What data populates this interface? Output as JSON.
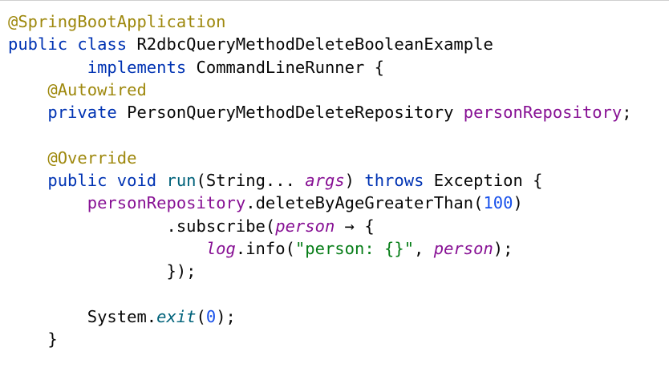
{
  "code_lines": [
    [
      {
        "kind": "annotation",
        "text": "@SpringBootApplication"
      }
    ],
    [
      {
        "kind": "keyword",
        "text": "public"
      },
      {
        "kind": "plain",
        "text": " "
      },
      {
        "kind": "keyword",
        "text": "class"
      },
      {
        "kind": "plain",
        "text": " R2dbcQueryMethodDeleteBooleanExample"
      }
    ],
    [
      {
        "kind": "plain",
        "text": "        "
      },
      {
        "kind": "keyword",
        "text": "implements"
      },
      {
        "kind": "plain",
        "text": " CommandLineRunner {"
      }
    ],
    [
      {
        "kind": "plain",
        "text": "    "
      },
      {
        "kind": "annotation",
        "text": "@Autowired"
      }
    ],
    [
      {
        "kind": "plain",
        "text": "    "
      },
      {
        "kind": "keyword",
        "text": "private"
      },
      {
        "kind": "plain",
        "text": " PersonQueryMethodDeleteRepository "
      },
      {
        "kind": "field",
        "text": "personRepository"
      },
      {
        "kind": "plain",
        "text": ";"
      }
    ],
    [],
    [
      {
        "kind": "plain",
        "text": "    "
      },
      {
        "kind": "annotation",
        "text": "@Override"
      }
    ],
    [
      {
        "kind": "plain",
        "text": "    "
      },
      {
        "kind": "keyword",
        "text": "public"
      },
      {
        "kind": "plain",
        "text": " "
      },
      {
        "kind": "keyword",
        "text": "void"
      },
      {
        "kind": "plain",
        "text": " "
      },
      {
        "kind": "method-decl",
        "text": "run"
      },
      {
        "kind": "plain",
        "text": "(String... "
      },
      {
        "kind": "param",
        "text": "args"
      },
      {
        "kind": "plain",
        "text": ") "
      },
      {
        "kind": "keyword",
        "text": "throws"
      },
      {
        "kind": "plain",
        "text": " Exception {"
      }
    ],
    [
      {
        "kind": "plain",
        "text": "        "
      },
      {
        "kind": "field",
        "text": "personRepository"
      },
      {
        "kind": "plain",
        "text": ".deleteByAgeGreaterThan("
      },
      {
        "kind": "number",
        "text": "100"
      },
      {
        "kind": "plain",
        "text": ")"
      }
    ],
    [
      {
        "kind": "plain",
        "text": "                .subscribe("
      },
      {
        "kind": "param",
        "text": "person"
      },
      {
        "kind": "plain",
        "text": " → {"
      }
    ],
    [
      {
        "kind": "plain",
        "text": "                    "
      },
      {
        "kind": "static-field",
        "text": "log"
      },
      {
        "kind": "plain",
        "text": ".info("
      },
      {
        "kind": "string",
        "text": "\"person: {}\""
      },
      {
        "kind": "plain",
        "text": ", "
      },
      {
        "kind": "param",
        "text": "person"
      },
      {
        "kind": "plain",
        "text": ");"
      }
    ],
    [
      {
        "kind": "plain",
        "text": "                });"
      }
    ],
    [],
    [
      {
        "kind": "plain",
        "text": "        System."
      },
      {
        "kind": "static",
        "text": "exit"
      },
      {
        "kind": "plain",
        "text": "("
      },
      {
        "kind": "number",
        "text": "0"
      },
      {
        "kind": "plain",
        "text": ");"
      }
    ],
    [
      {
        "kind": "plain",
        "text": "    }"
      }
    ]
  ],
  "colors": {
    "background": "#ffffff",
    "annotation": "#9e880d",
    "keyword": "#0033b3",
    "field": "#871094",
    "method_declaration": "#00627a",
    "number": "#1750eb",
    "string": "#067d17",
    "plain": "#080808"
  }
}
